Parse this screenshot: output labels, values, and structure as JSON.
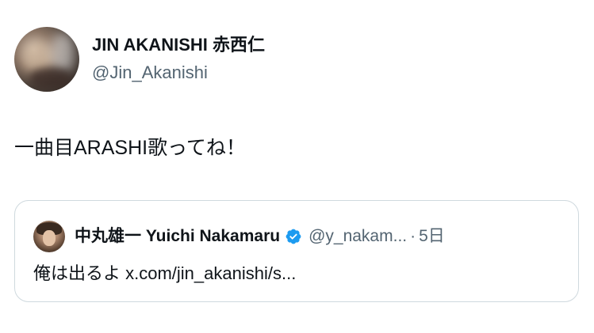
{
  "author": {
    "display_name": "JIN AKANISHI 赤西仁",
    "handle": "@Jin_Akanishi"
  },
  "tweet": {
    "text": "一曲目ARASHI歌ってね！"
  },
  "quoted_tweet": {
    "author_name": "中丸雄一 Yuichi Nakamaru",
    "verified_icon": "verified-badge-icon",
    "handle": "@y_nakam...",
    "separator": "·",
    "time": "5日",
    "text": "俺は出るよ x.com/jin_akanishi/s..."
  },
  "colors": {
    "text_primary": "#0f1419",
    "text_secondary": "#536471",
    "border": "#cfd9de",
    "verified_blue": "#1d9bf0"
  }
}
